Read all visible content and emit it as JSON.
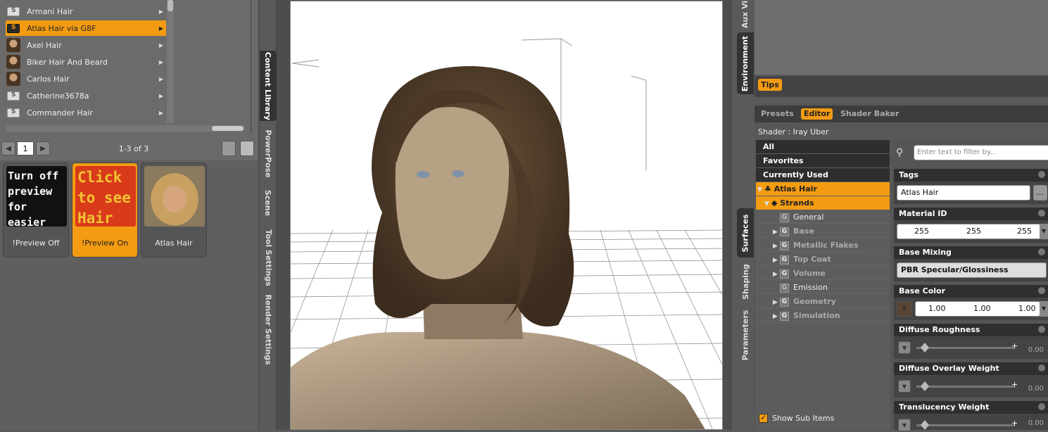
{
  "content_library": {
    "items": [
      {
        "label": "Armani Hair",
        "icon": "folder-icon"
      },
      {
        "label": "Atlas Hair via G8F",
        "icon": "folder-icon",
        "selected": true
      },
      {
        "label": "Axel Hair",
        "icon": "avatar"
      },
      {
        "label": "Biker Hair And Beard",
        "icon": "avatar"
      },
      {
        "label": "Carlos Hair",
        "icon": "avatar"
      },
      {
        "label": "Catherine3678a",
        "icon": "folder-icon"
      },
      {
        "label": "Commander Hair",
        "icon": "folder-icon"
      }
    ],
    "page_number": "1",
    "page_count": "1-3 of 3",
    "cards": [
      {
        "caption": "!Preview Off",
        "image_text": "Turn off preview for easier use"
      },
      {
        "caption": "!Preview On",
        "image_text": "Click to see Hair",
        "selected": true
      },
      {
        "caption": "Atlas Hair"
      }
    ]
  },
  "left_tabs": [
    "Content Library",
    "PowerPose",
    "Scene",
    "Tool Settings",
    "Render Settings"
  ],
  "right_tabs": [
    "Aux Vi",
    "Environment",
    "Surfaces",
    "Shaping",
    "Parameters"
  ],
  "tips_label": "Tips",
  "surfaces": {
    "tabs": [
      "Presets",
      "Editor",
      "Shader Baker"
    ],
    "shader_label": "Shader : Iray Uber",
    "filters": [
      "All",
      "Favorites",
      "Currently Used"
    ],
    "tree": {
      "root": "Atlas Hair",
      "child": "Strands",
      "groups": [
        {
          "label": "General",
          "expandable": false
        },
        {
          "label": "Base",
          "expandable": true
        },
        {
          "label": "Metallic Flakes",
          "expandable": true
        },
        {
          "label": "Top Coat",
          "expandable": true
        },
        {
          "label": "Volume",
          "expandable": true
        },
        {
          "label": "Emission",
          "expandable": false
        },
        {
          "label": "Geometry",
          "expandable": true
        },
        {
          "label": "Simulation",
          "expandable": true
        }
      ]
    },
    "show_sub_items": "Show Sub Items",
    "filter_placeholder": "Enter text to filter by...",
    "properties": {
      "tags": {
        "label": "Tags",
        "value": "Atlas Hair",
        "more": "..."
      },
      "material_id": {
        "label": "Material ID",
        "values": [
          "255",
          "255",
          "255"
        ]
      },
      "base_mixing": {
        "label": "Base Mixing",
        "value": "PBR Specular/Glossiness"
      },
      "base_color": {
        "label": "Base Color",
        "values": [
          "1.00",
          "1.00",
          "1.00"
        ]
      },
      "diffuse_roughness": {
        "label": "Diffuse Roughness",
        "value": "0.00"
      },
      "diffuse_overlay_weight": {
        "label": "Diffuse Overlay Weight",
        "value": "0.00"
      },
      "translucency_weight": {
        "label": "Translucency Weight",
        "value": "0.00"
      }
    }
  },
  "colors": {
    "accent": "#f39c12",
    "panel": "#5a5a5a",
    "dark": "#2e2e2e"
  }
}
